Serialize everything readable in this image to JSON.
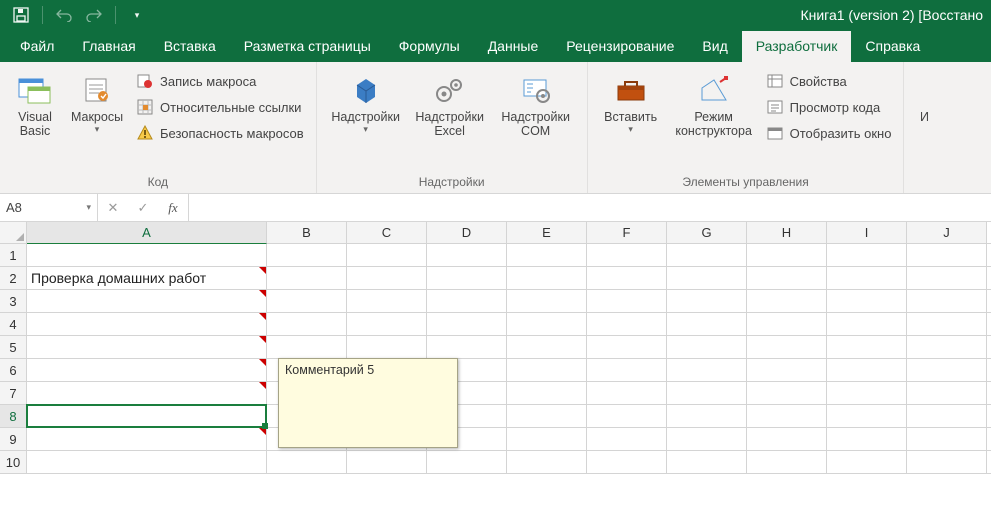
{
  "titlebar": {
    "title": "Книга1 (version 2) [Восстано"
  },
  "tabs": {
    "items": [
      {
        "label": "Файл"
      },
      {
        "label": "Главная"
      },
      {
        "label": "Вставка"
      },
      {
        "label": "Разметка страницы"
      },
      {
        "label": "Формулы"
      },
      {
        "label": "Данные"
      },
      {
        "label": "Рецензирование"
      },
      {
        "label": "Вид"
      },
      {
        "label": "Разработчик",
        "active": true
      },
      {
        "label": "Справка"
      }
    ]
  },
  "ribbon": {
    "code": {
      "visual_basic": "Visual Basic",
      "macros": "Макросы",
      "record": "Запись макроса",
      "relative": "Относительные ссылки",
      "security": "Безопасность макросов",
      "group_label": "Код"
    },
    "addins": {
      "addins": "Надстройки",
      "excel_addins": "Надстройки Excel",
      "com_addins": "Надстройки COM",
      "group_label": "Надстройки"
    },
    "controls": {
      "insert": "Вставить",
      "design_mode": "Режим конструктора",
      "properties": "Свойства",
      "view_code": "Просмотр кода",
      "run_dialog": "Отобразить окно",
      "group_label": "Элементы управления"
    },
    "xml_partial": "И"
  },
  "formulabar": {
    "namebox": "A8",
    "formula": ""
  },
  "sheet": {
    "columns": [
      "A",
      "B",
      "C",
      "D",
      "E",
      "F",
      "G",
      "H",
      "I",
      "J"
    ],
    "rows": [
      "1",
      "2",
      "3",
      "4",
      "5",
      "6",
      "7",
      "8",
      "9",
      "10"
    ],
    "cells": {
      "A2": "Проверка домашних работ"
    },
    "comment_indicators": [
      "A2",
      "A3",
      "A4",
      "A5",
      "A6",
      "A7",
      "A9"
    ],
    "selected_cell": "A8",
    "visible_comment": {
      "for": "A4",
      "text": "Комментарий 5"
    }
  }
}
